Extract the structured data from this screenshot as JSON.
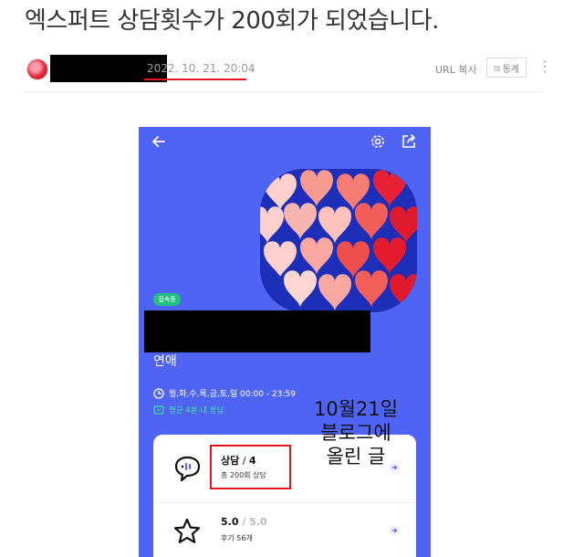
{
  "post": {
    "title": "엑스퍼트 상담횟수가 200회가 되었습니다.",
    "date": "2022. 10. 21. 20:04",
    "url_copy": "URL 복사",
    "stats_label": "통계"
  },
  "app": {
    "status_badge": "접속중",
    "category": "연애",
    "hours": "월,화,수,목,금,토,일  00:00 - 23:59",
    "response": "평균 4분 내 응답",
    "consult_label": "상담",
    "consult_sep": " / ",
    "consult_count": "4",
    "consult_total": "총 200회 상담",
    "rating": "5.0",
    "rating_sep": " / ",
    "rating_max": "5.0",
    "reviews": "후기 56개"
  },
  "annotation": {
    "line1": "10월21일",
    "line2": "블로그에",
    "line3": "올린 글"
  },
  "colors": {
    "phone_bg": "#4f63f5",
    "highlight": "#e4151f",
    "online": "#21c07e"
  },
  "icons": [
    "back-icon",
    "gear-icon",
    "share-icon",
    "clock-icon",
    "response-icon",
    "chat-icon",
    "star-icon",
    "arrow-right-icon",
    "more-icon"
  ]
}
